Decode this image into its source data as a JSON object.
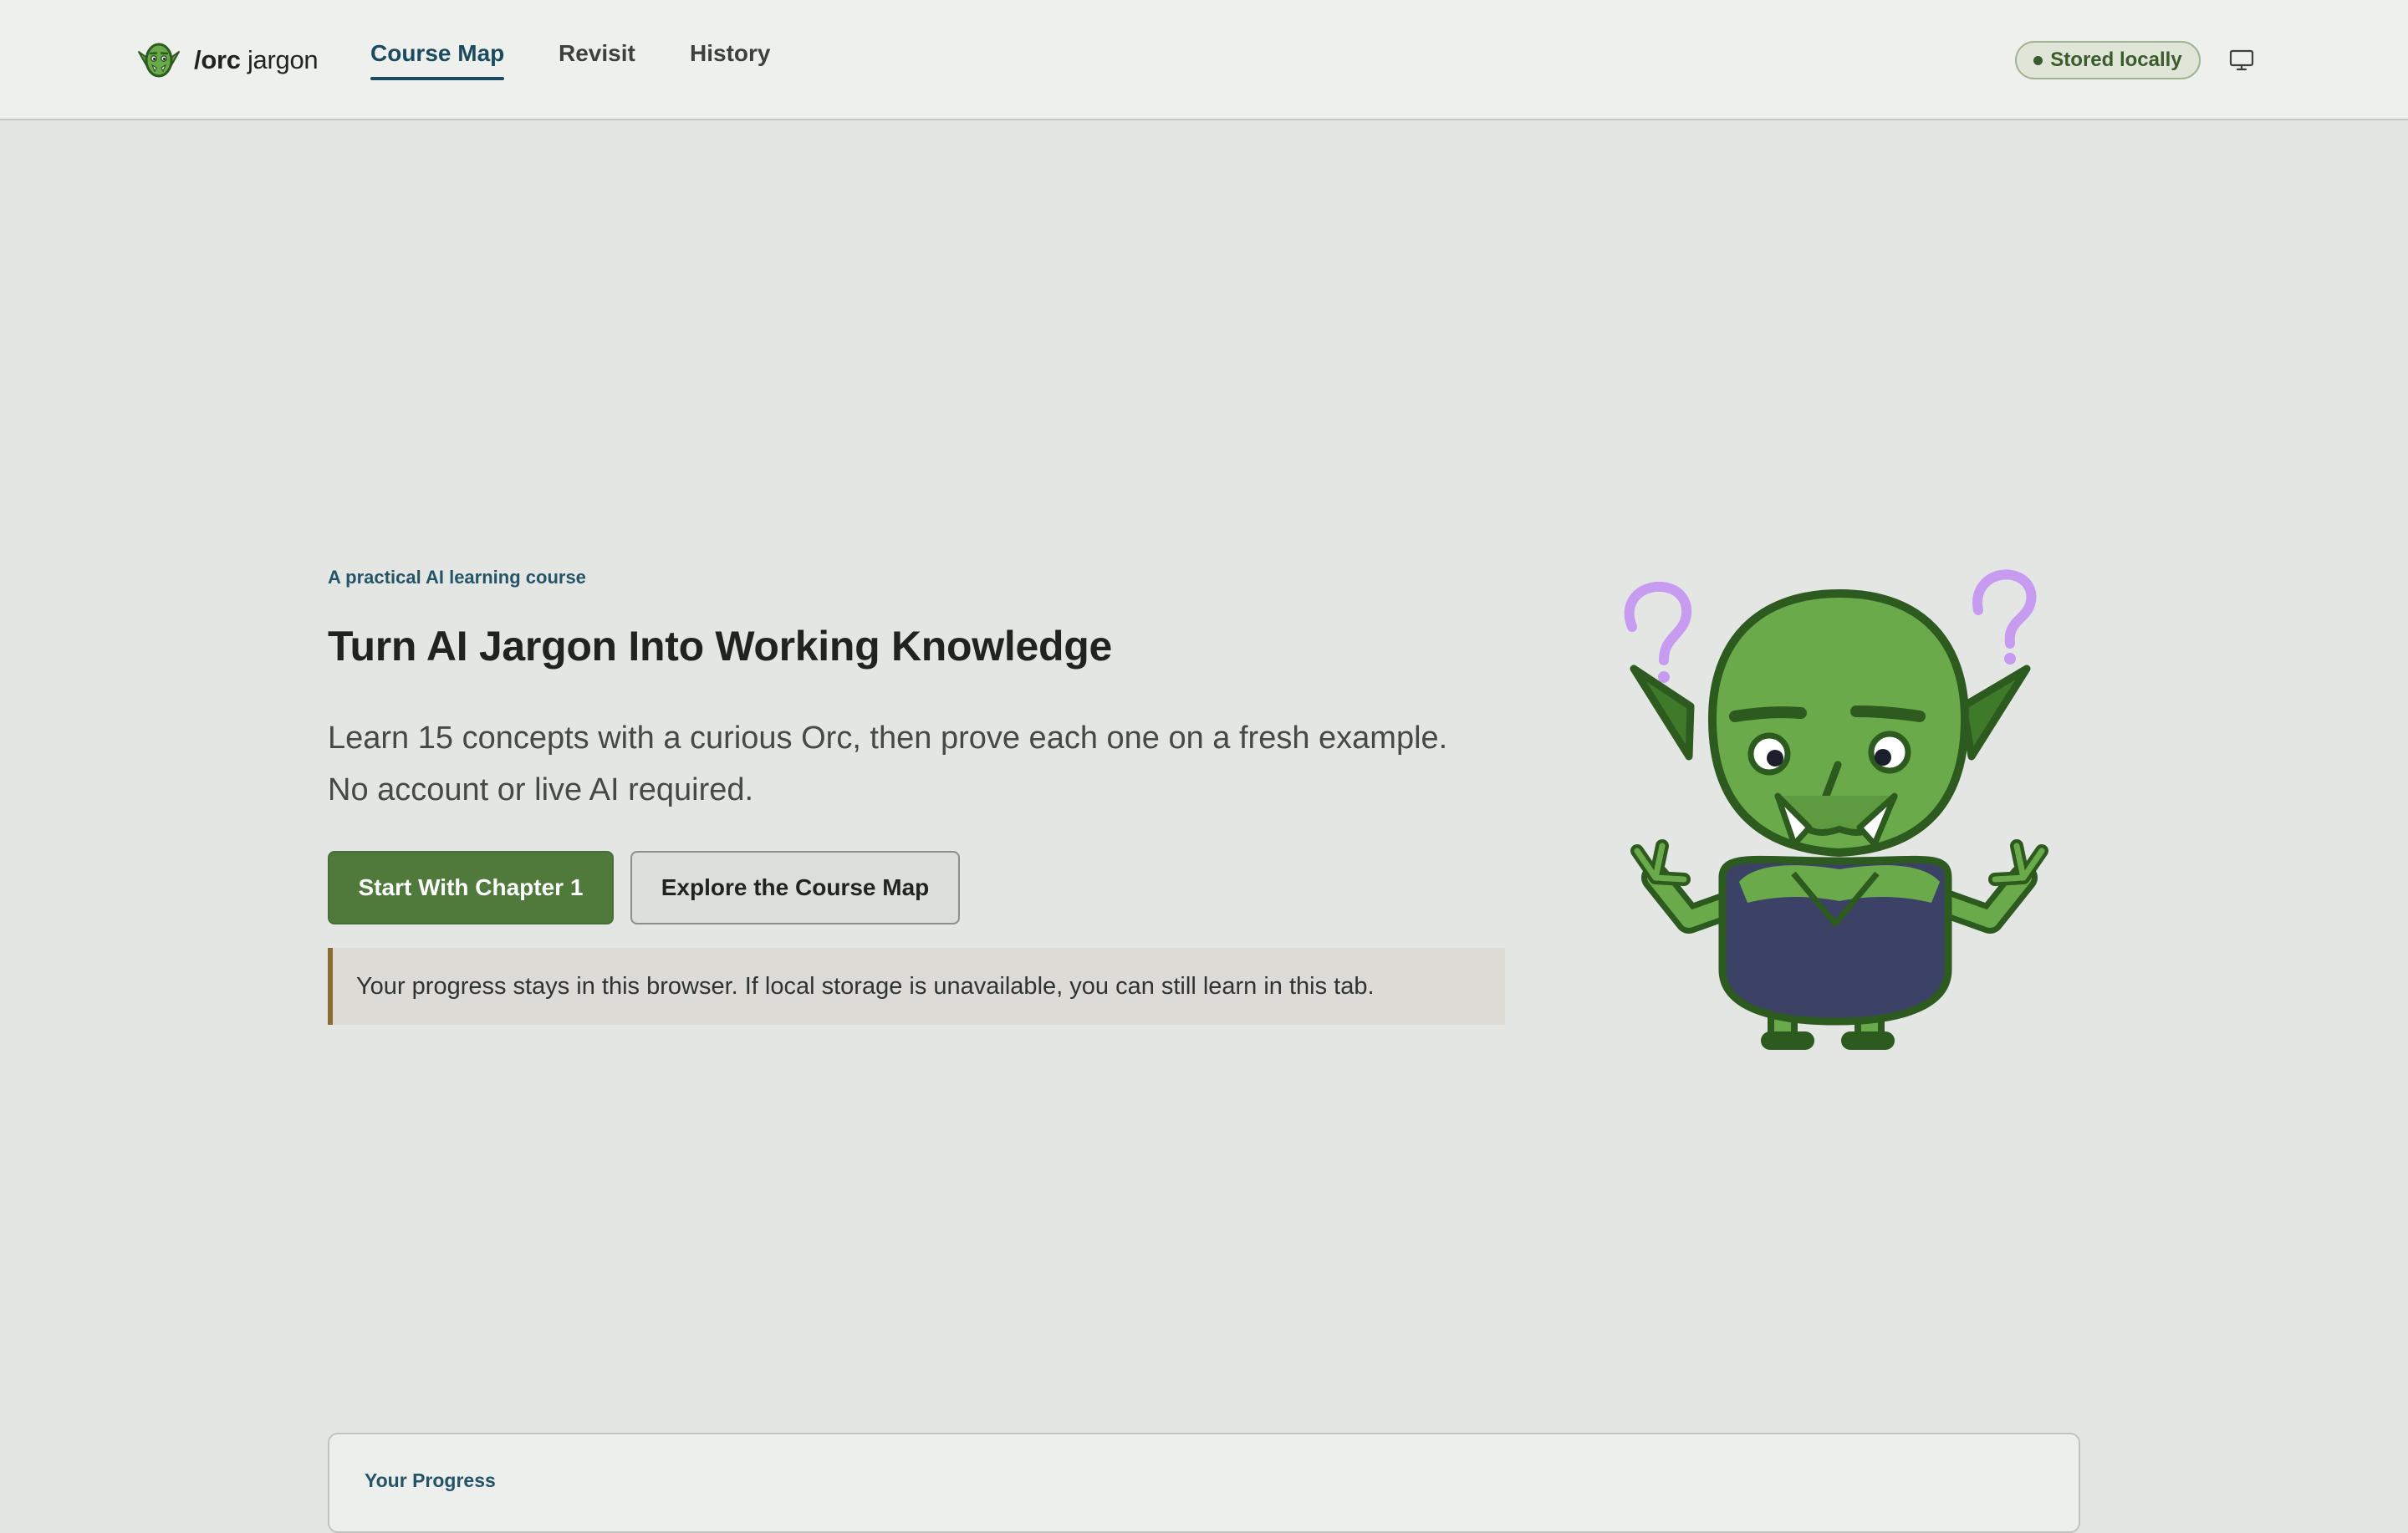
{
  "header": {
    "brand": {
      "slash": "/orc",
      "rest": " jargon",
      "logo_icon": "orc-face-icon"
    },
    "nav": [
      {
        "label": "Course Map",
        "active": true
      },
      {
        "label": "Revisit",
        "active": false
      },
      {
        "label": "History",
        "active": false
      }
    ],
    "status_badge": "Stored locally",
    "monitor_icon": "monitor-icon"
  },
  "hero": {
    "eyebrow": "A practical AI learning course",
    "title": "Turn AI Jargon Into Working Knowledge",
    "lede": "Learn 15 concepts with a curious Orc, then prove each one on a fresh example. No account or live AI required.",
    "primary_button": "Start With Chapter 1",
    "secondary_button": "Explore the Course Map",
    "note": "Your progress stays in this browser. If local storage is unavailable, you can still learn in this tab.",
    "mascot_icon": "confused-orc-illustration"
  },
  "progress": {
    "title": "Your Progress"
  },
  "colors": {
    "accent_blue": "#1c4a5e",
    "primary_green": "#4f7a3b",
    "orc_green": "#6aaa4a",
    "orc_outline": "#2d5a1e",
    "question_purple": "#c79cf0",
    "note_border": "#8a6a2e"
  }
}
